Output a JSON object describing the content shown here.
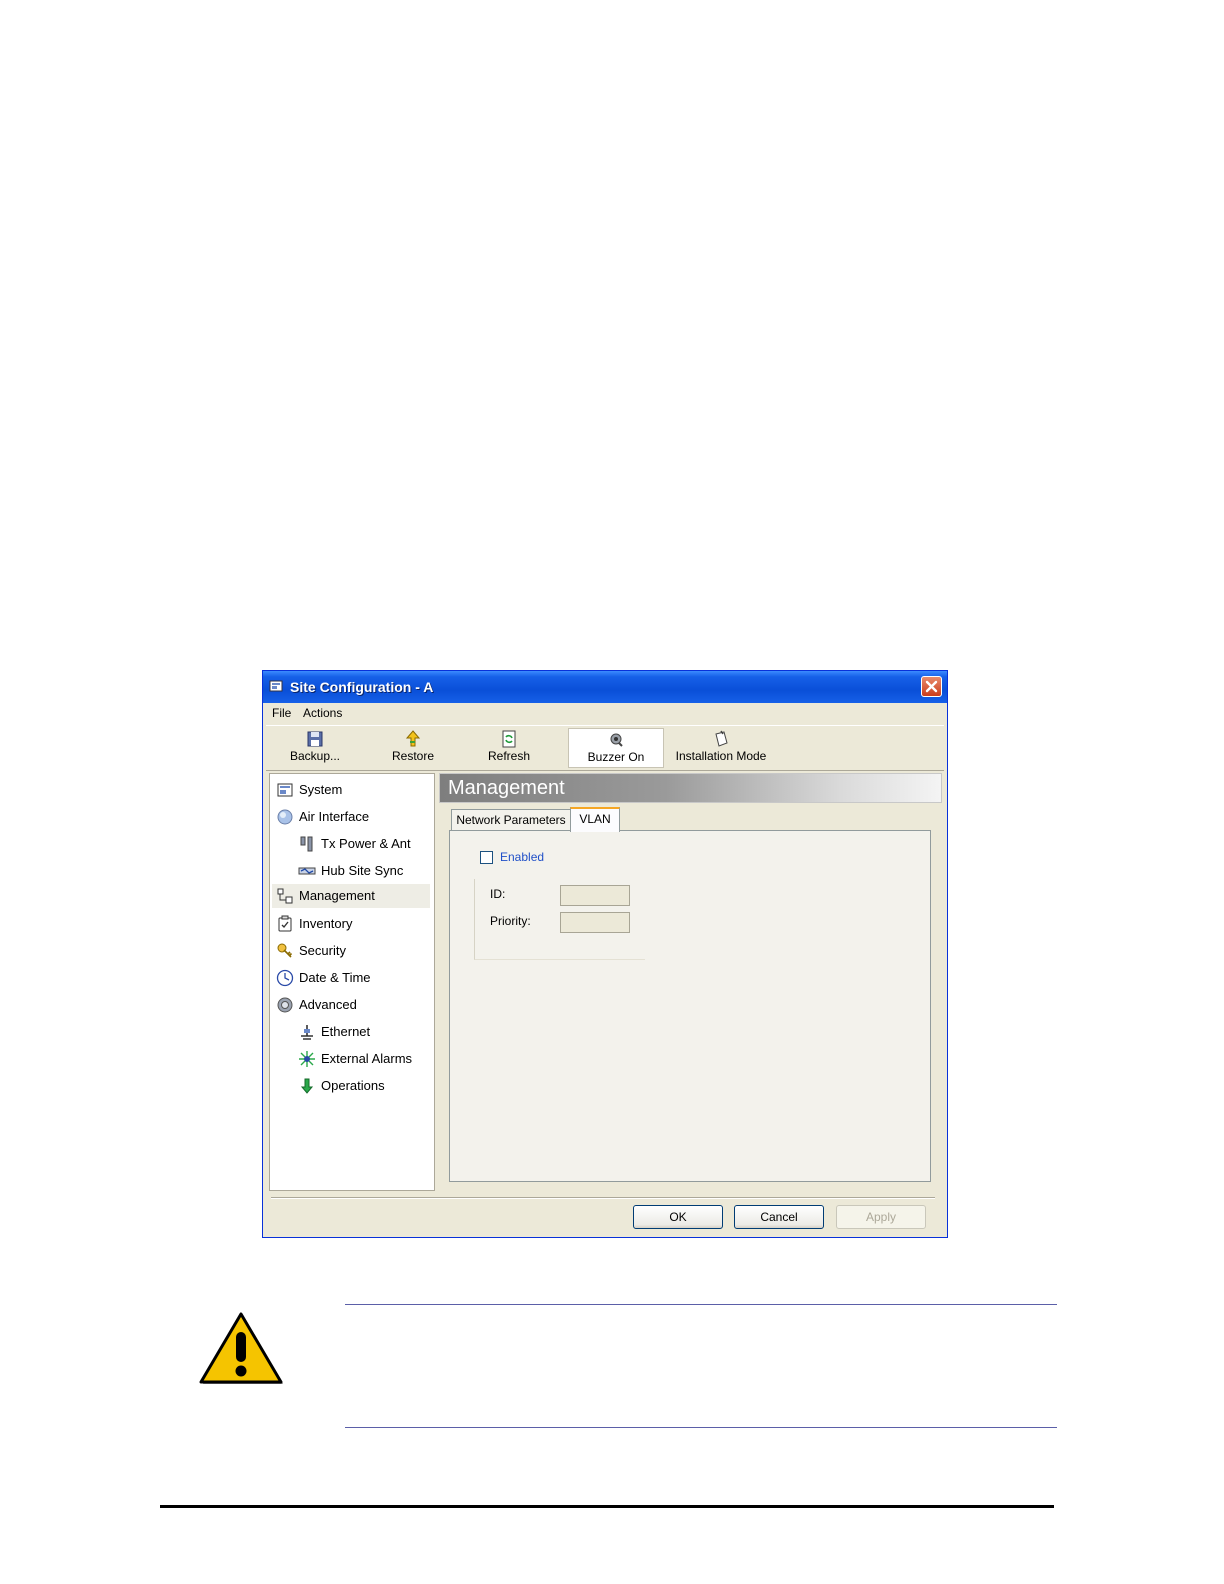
{
  "window": {
    "title": "Site Configuration - A"
  },
  "menu": {
    "items": [
      "File",
      "Actions"
    ]
  },
  "toolbar": {
    "backup": "Backup...",
    "restore": "Restore",
    "refresh": "Refresh",
    "buzzer": "Buzzer On",
    "installation_mode": "Installation Mode"
  },
  "nav": {
    "items": [
      {
        "label": "System",
        "icon": "system-icon"
      },
      {
        "label": "Air Interface",
        "icon": "air-interface-icon"
      },
      {
        "label": "Tx Power & Ant",
        "icon": "antenna-icon"
      },
      {
        "label": "Hub Site Sync",
        "icon": "sync-icon"
      },
      {
        "label": "Management",
        "icon": "management-icon"
      },
      {
        "label": "Inventory",
        "icon": "inventory-icon"
      },
      {
        "label": "Security",
        "icon": "security-icon"
      },
      {
        "label": "Date & Time",
        "icon": "clock-icon"
      },
      {
        "label": "Advanced",
        "icon": "advanced-icon"
      },
      {
        "label": "Ethernet",
        "icon": "ethernet-icon"
      },
      {
        "label": "External Alarms",
        "icon": "alarm-icon"
      },
      {
        "label": "Operations",
        "icon": "operations-icon"
      }
    ],
    "selected": "Management"
  },
  "content": {
    "title": "Management",
    "tabs": [
      "Network Parameters",
      "VLAN"
    ],
    "active_tab": "VLAN",
    "vlan": {
      "enabled_label": "Enabled",
      "enabled": false,
      "id_label": "ID:",
      "id_value": "",
      "priority_label": "Priority:",
      "priority_value": ""
    }
  },
  "buttons": {
    "ok": "OK",
    "cancel": "Cancel",
    "apply": "Apply"
  },
  "colors": {
    "titlebar": "#0a4fd8",
    "window_bg": "#ece9d8",
    "active_tab_accent": "#f5a623",
    "warning_yellow": "#f5c400"
  }
}
